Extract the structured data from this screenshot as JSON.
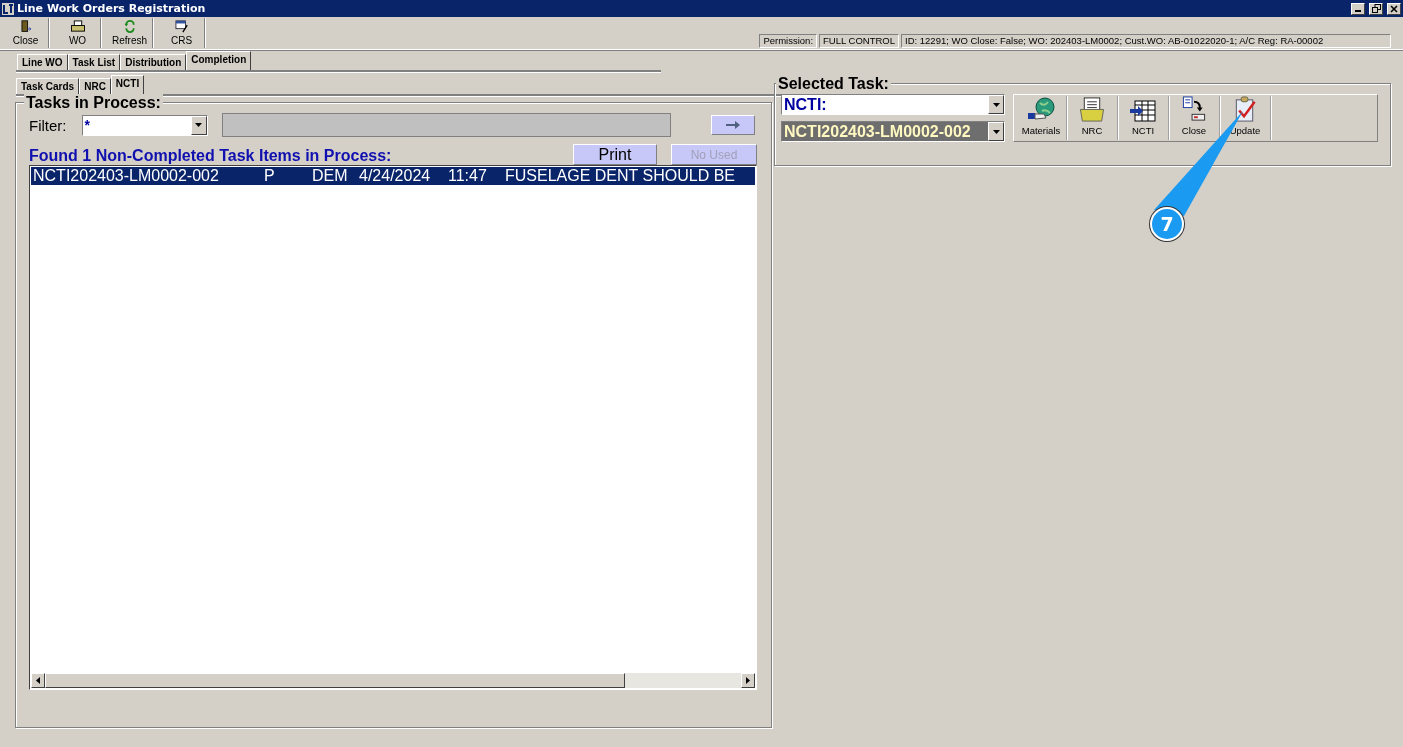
{
  "window": {
    "title": "Line Work Orders Registration"
  },
  "toolbar": [
    {
      "label": "Close",
      "kind": "door"
    },
    {
      "label": "WO",
      "kind": "printer"
    },
    {
      "label": "Refresh",
      "kind": "refresh"
    },
    {
      "label": "CRS",
      "kind": "form"
    }
  ],
  "status": {
    "permission_label": "Permission:",
    "permission": "FULL CONTROL",
    "info": "ID: 12291; WO Close: False; WO: 202403-LM0002; Cust.WO: AB-01022020-1; A/C Reg: RA-00002"
  },
  "tabs": [
    {
      "label": "Line WO",
      "selected": false
    },
    {
      "label": "Task List",
      "selected": false
    },
    {
      "label": "Distribution",
      "selected": false
    },
    {
      "label": "Completion",
      "selected": true
    }
  ],
  "subtabs": [
    {
      "label": "Task Cards",
      "selected": false
    },
    {
      "label": "NRC",
      "selected": false
    },
    {
      "label": "NCTI",
      "selected": true
    }
  ],
  "tasks_panel": {
    "title": "Tasks in Process:",
    "filter_label": "Filter:",
    "filter_value": "*",
    "found_text": "Found 1 Non-Completed Task Items in Process:",
    "print_button": {
      "label": "Print",
      "disabled": false
    },
    "no_used_button": {
      "label": "No Used",
      "disabled": true
    },
    "rows": [
      {
        "cells": [
          "NCTI202403-LM0002-002",
          "P",
          "DEM",
          "4/24/2024",
          "11:47",
          "FUSELAGE DENT SHOULD BE"
        ],
        "selected": true
      }
    ]
  },
  "selected_task": {
    "title": "Selected Task:",
    "type_value": "NCTI:",
    "task_value": "NCTI202403-LM0002-002",
    "actions": [
      {
        "label": "Materials",
        "kind": "globe"
      },
      {
        "label": "NRC",
        "kind": "folder"
      },
      {
        "label": "NCTI",
        "kind": "grid"
      },
      {
        "label": "Close",
        "kind": "close-doc"
      },
      {
        "label": "Update",
        "kind": "clipboard"
      }
    ]
  },
  "callout": {
    "label": "7"
  }
}
